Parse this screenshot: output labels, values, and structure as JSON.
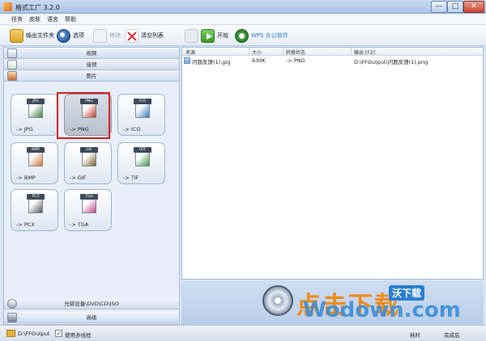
{
  "window": {
    "title": "格式工厂 3.2.0",
    "buttons": {
      "minimize": "—",
      "maximize": "□",
      "close": "✕"
    }
  },
  "menu": [
    "任务",
    "皮肤",
    "语言",
    "帮助"
  ],
  "toolbar": {
    "output_folder": "输出文件夹",
    "options": "选项",
    "remove": "移除",
    "clear_list": "清空列表",
    "stop": "停止",
    "start": "开始",
    "wps": "WPS 办公软件"
  },
  "categories": {
    "video": "视频",
    "audio": "音频",
    "image": "图片",
    "rom": "光驱设备\\DVD\\CD\\ISO",
    "advanced": "高级"
  },
  "tiles": [
    {
      "badge": "JPG",
      "label": "-> JPG",
      "color": "#3a7d3a"
    },
    {
      "badge": "PNG",
      "label": "-> PNG",
      "color": "#c0392b"
    },
    {
      "badge": "ICO",
      "label": "-> ICO",
      "color": "#2f7bc4"
    },
    {
      "badge": "BMP",
      "label": "-> BMP",
      "color": "#d8742c"
    },
    {
      "badge": "GIF",
      "label": "-> GIF",
      "color": "#7b5a2a"
    },
    {
      "badge": "TIFF",
      "label": "-> TIF",
      "color": "#3d9a4a"
    },
    {
      "badge": "PCX",
      "label": "-> PCX",
      "color": "#5a5a5a"
    },
    {
      "badge": "TGA",
      "label": "-> TGA",
      "color": "#c2438a"
    }
  ],
  "task_list": {
    "headers": {
      "source": "来源",
      "size": "大小",
      "status": "转换状态",
      "output": "输出 [F2]"
    },
    "rows": [
      {
        "source": "问题反馈(1).jpg",
        "size": "630K",
        "status": "-> PNG",
        "output": "D:\\FFOutput\\问题反馈(1).png"
      }
    ]
  },
  "status_bar": {
    "output_path": "D:\\FFOutput",
    "multithread_checked": "✓",
    "multithread_label": "使用多线程",
    "elapsed_label": "耗时",
    "after_done_label": "完成后"
  },
  "banner": {
    "text": "点击下载",
    "logo": "沃下载",
    "watermark": "Wodown.com"
  },
  "colors": {
    "selection_frame": "#d91e1e",
    "accent": "#2f7bc4",
    "start_green": "#3e9a2c"
  }
}
